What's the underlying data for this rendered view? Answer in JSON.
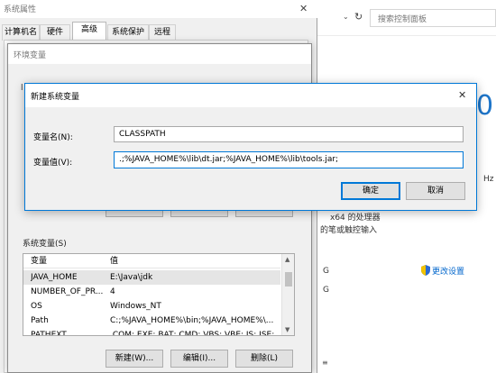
{
  "control_panel": {
    "search_placeholder": "搜索控制面板",
    "big_digit": "0",
    "text_hz": "Hz",
    "text_processor": "x64 的处理器",
    "text_touch": "的笔或触控输入",
    "text_g1": "G",
    "text_g2": "G",
    "change_settings": "更改设置"
  },
  "system_properties": {
    "title": "系统属性",
    "tabs": [
      "计算机名",
      "硬件",
      "高级",
      "系统保护",
      "远程"
    ],
    "close_glyph": "✕"
  },
  "env_vars": {
    "title": "环境变量",
    "user_label_fragment": "l",
    "system_section_label": "系统变量(S)",
    "columns": [
      "变量",
      "值"
    ],
    "rows": [
      {
        "name": "JAVA_HOME",
        "value": "E:\\Java\\jdk"
      },
      {
        "name": "NUMBER_OF_PR...",
        "value": "4"
      },
      {
        "name": "OS",
        "value": "Windows_NT"
      },
      {
        "name": "Path",
        "value": "C:;%JAVA_HOME%\\bin;%JAVA_HOME%\\..."
      },
      {
        "name": "PATHEXT",
        "value": ".COM;.EXE;.BAT;.CMD;.VBS;.VBE;.JS;.JSE;..."
      }
    ],
    "buttons": {
      "new": "新建(W)...",
      "edit": "编辑(I)...",
      "delete": "删除(L)"
    }
  },
  "new_var_dialog": {
    "title": "新建系统变量",
    "name_label": "变量名(N):",
    "name_value": "CLASSPATH",
    "value_label": "变量值(V):",
    "value_value": ".;%JAVA_HOME%\\lib\\dt.jar;%JAVA_HOME%\\lib\\tools.jar;",
    "ok": "确定",
    "cancel": "取消",
    "close_glyph": "✕"
  },
  "colors": {
    "accent": "#0078d7",
    "link": "#0066cc",
    "shield_blue": "#2b6cd4",
    "shield_yellow": "#f2c200"
  }
}
